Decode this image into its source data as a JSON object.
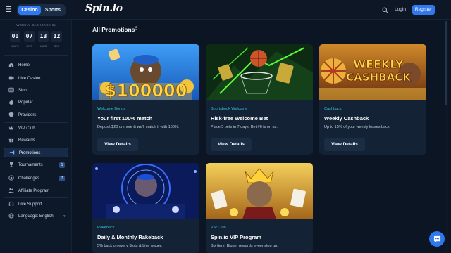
{
  "topbar": {
    "casino_label": "Casino",
    "sports_label": "Sports",
    "logo_text": "Spin.io",
    "login_label": "Login",
    "register_label": "Register"
  },
  "cashback": {
    "title": "WEEKLY CASHBACK IN",
    "days": "00",
    "hrs": "07",
    "mins": "13",
    "sec": "12",
    "days_label": "DAYS",
    "hrs_label": "HRS",
    "mins_label": "MINS",
    "sec_label": "SEC"
  },
  "sidebar": {
    "items": [
      {
        "label": "Home",
        "icon": "home-icon"
      },
      {
        "label": "Live Casino",
        "icon": "live-icon"
      },
      {
        "label": "Slots",
        "icon": "slots-icon"
      },
      {
        "label": "Popular",
        "icon": "fire-icon"
      },
      {
        "label": "Providers",
        "icon": "shield-icon"
      },
      {
        "label": "VIP Club",
        "icon": "crown-icon"
      },
      {
        "label": "Rewards",
        "icon": "gift-icon"
      },
      {
        "label": "Promotions",
        "icon": "megaphone-icon",
        "active": true
      },
      {
        "label": "Tournaments",
        "icon": "trophy-icon",
        "badge": "1"
      },
      {
        "label": "Challenges",
        "icon": "target-icon",
        "badge": "7"
      },
      {
        "label": "Affiliate Program",
        "icon": "users-icon"
      },
      {
        "label": "Live Support",
        "icon": "headset-icon"
      },
      {
        "label": "Language: English",
        "icon": "globe-icon"
      }
    ]
  },
  "main": {
    "heading": "All Promotions",
    "count": "5",
    "cards": [
      {
        "tag": "Welcome Bonus",
        "title": "Your first 100% match",
        "desc": "Deposit $20 or more & we'll match it with 100%.",
        "button": "View Details",
        "image_text": "$100000"
      },
      {
        "tag": "Sportsbook Welcome",
        "title": "Risk-free Welcome Bet",
        "desc": "Place 5 bets in 7 days. Bet #6 is on us.",
        "button": "View Details"
      },
      {
        "tag": "Cashback",
        "title": "Weekly Cashback",
        "desc": "Up to 15% of your weekly losses back.",
        "button": "View Details",
        "image_text_1": "WEEKLY",
        "image_text_2": "CASHBACK"
      },
      {
        "tag": "Rakeback",
        "title": "Daily & Monthly Rakeback",
        "desc": "5% back on every Slots & Live wager.",
        "button": "View Details"
      },
      {
        "tag": "VIP Club",
        "title": "Spin.io VIP Program",
        "desc": "Six tiers. Bigger rewards every step up.",
        "button": "View Details"
      }
    ]
  },
  "colors": {
    "accent": "#2f78ee",
    "tag": "#35c0d6",
    "bg": "#0b1524",
    "card": "#142236"
  }
}
